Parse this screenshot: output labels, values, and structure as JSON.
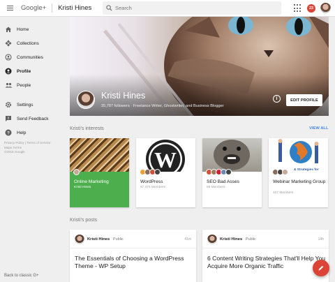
{
  "topbar": {
    "brand": "Google+",
    "page_name": "Kristi Hines",
    "search_placeholder": "Search",
    "notification_count": "23",
    "colors": {
      "notification": "#db4437"
    }
  },
  "sidebar": {
    "items": [
      {
        "label": "Home",
        "icon": "home-icon"
      },
      {
        "label": "Collections",
        "icon": "collections-icon"
      },
      {
        "label": "Communities",
        "icon": "communities-icon"
      },
      {
        "label": "Profile",
        "icon": "profile-icon"
      },
      {
        "label": "People",
        "icon": "people-icon"
      },
      {
        "label": "Settings",
        "icon": "gear-icon"
      },
      {
        "label": "Send Feedback",
        "icon": "feedback-icon"
      },
      {
        "label": "Help",
        "icon": "help-icon"
      }
    ],
    "footer": {
      "privacy": "Privacy Policy",
      "sep": "|",
      "terms": "Terms of Service",
      "maps": "Maps Terms",
      "copyright": "©2015 Google"
    },
    "back_classic": "Back to classic G+"
  },
  "profile": {
    "name": "Kristi Hines",
    "subtitle": "35,787 followers · Freelance Writer, Ghostwriter, and Business Blogger",
    "edit_button": "EDIT PROFILE"
  },
  "interests": {
    "title": "Kristi's interests",
    "view_all": "VIEW ALL",
    "cards": [
      {
        "title": "Online Marketing",
        "subtitle": "Kristi Hines"
      },
      {
        "title": "WordPress",
        "subtitle": "67,474 Members"
      },
      {
        "title": "SEO Bad Asses",
        "subtitle": "59 Members"
      },
      {
        "title": "Webinar Marketing Group",
        "subtitle": "407 Members"
      }
    ],
    "card4_overlay": "& Strategies for"
  },
  "posts": {
    "title": "Kristi's posts",
    "items": [
      {
        "author": "Kristi Hines",
        "visibility": "Public",
        "time": "41m",
        "text": "The Essentials of Choosing a WordPress Theme - WP Setup"
      },
      {
        "author": "Kristi Hines",
        "visibility": "Public",
        "time": "14h",
        "text": "6 Content Writing Strategies That'll Help You Acquire More Organic Traffic"
      }
    ]
  }
}
